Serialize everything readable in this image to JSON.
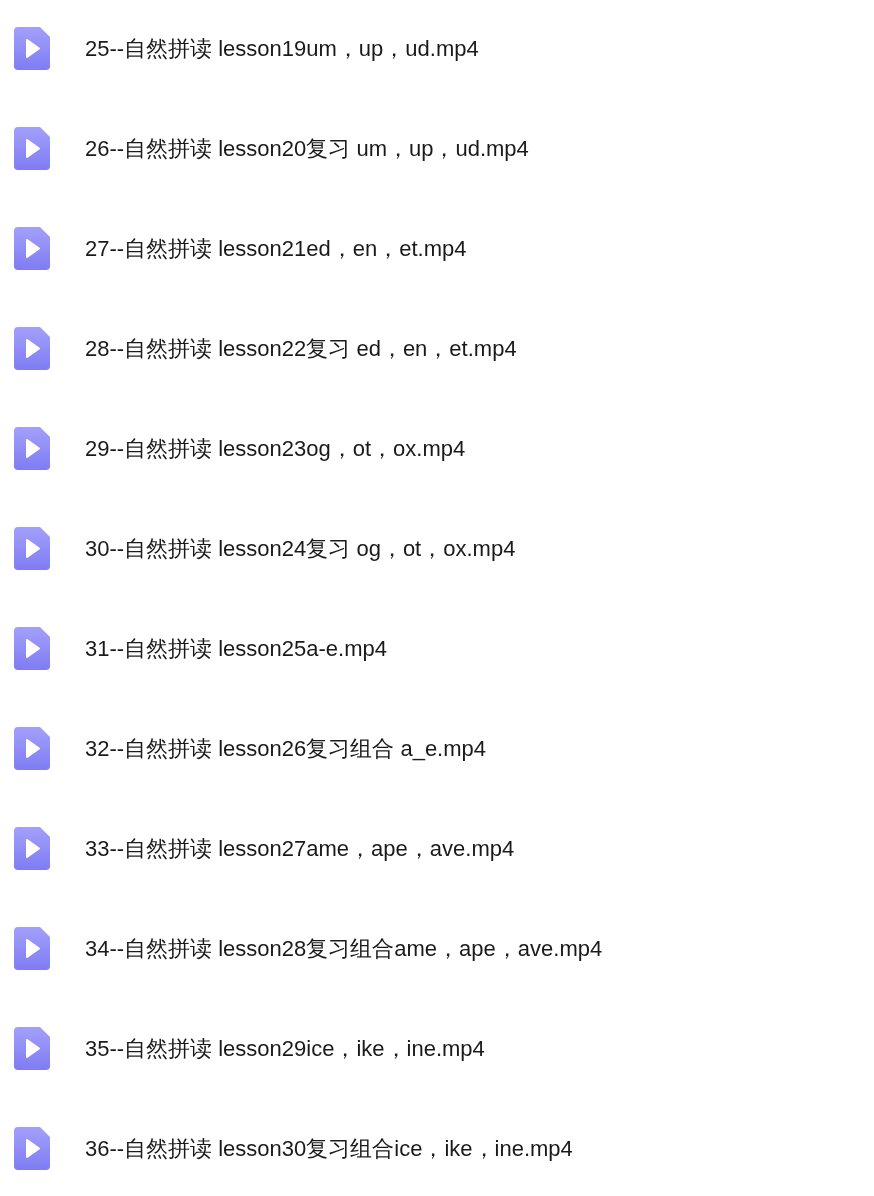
{
  "files": [
    {
      "name": "25--自然拼读 lesson19um，up，ud.mp4"
    },
    {
      "name": "26--自然拼读 lesson20复习 um，up，ud.mp4"
    },
    {
      "name": "27--自然拼读 lesson21ed，en，et.mp4"
    },
    {
      "name": "28--自然拼读 lesson22复习 ed，en，et.mp4"
    },
    {
      "name": "29--自然拼读 lesson23og，ot，ox.mp4"
    },
    {
      "name": "30--自然拼读 lesson24复习 og，ot，ox.mp4"
    },
    {
      "name": "31--自然拼读 lesson25a-e.mp4"
    },
    {
      "name": "32--自然拼读 lesson26复习组合 a_e.mp4"
    },
    {
      "name": "33--自然拼读 lesson27ame，ape，ave.mp4"
    },
    {
      "name": "34--自然拼读 lesson28复习组合ame，ape，ave.mp4"
    },
    {
      "name": "35--自然拼读 lesson29ice，ike，ine.mp4"
    },
    {
      "name": "36--自然拼读 lesson30复习组合ice，ike，ine.mp4"
    }
  ]
}
